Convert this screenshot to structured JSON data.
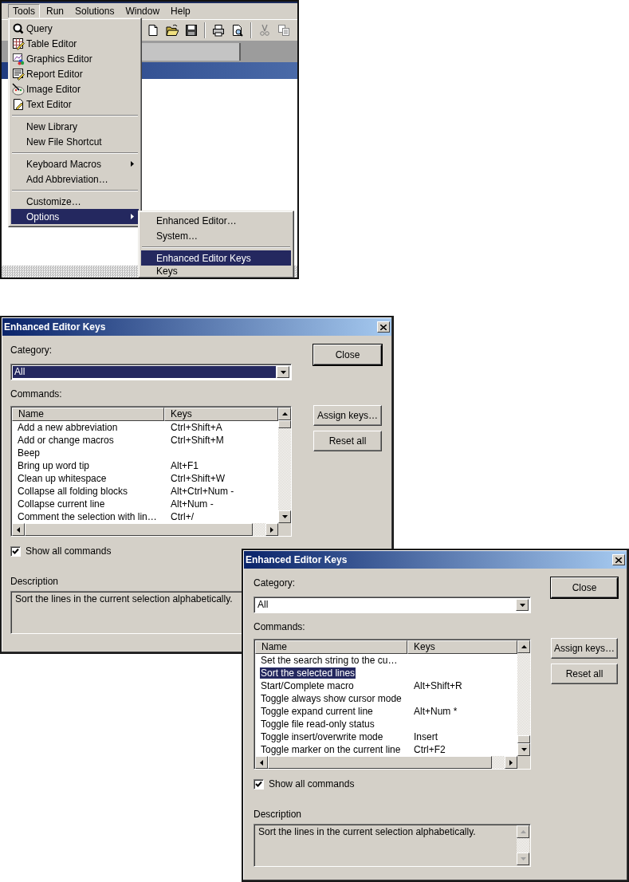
{
  "menu_screenshot": {
    "menubar": [
      {
        "label": "Tools",
        "selected": true
      },
      {
        "label": "Run",
        "selected": false
      },
      {
        "label": "Solutions",
        "selected": false
      },
      {
        "label": "Window",
        "selected": false
      },
      {
        "label": "Help",
        "selected": false
      }
    ],
    "tools_menu": {
      "groups": [
        [
          {
            "label": "Query",
            "kind": "icon",
            "submenu": false,
            "selected": false
          },
          {
            "label": "Table Editor",
            "kind": "icon",
            "submenu": false,
            "selected": false
          },
          {
            "label": "Graphics Editor",
            "kind": "icon",
            "submenu": false,
            "selected": false
          },
          {
            "label": "Report Editor",
            "kind": "icon",
            "submenu": false,
            "selected": false
          },
          {
            "label": "Image Editor",
            "kind": "icon",
            "submenu": false,
            "selected": false
          },
          {
            "label": "Text Editor",
            "kind": "icon",
            "submenu": false,
            "selected": false
          }
        ],
        [
          {
            "label": "New Library",
            "kind": "plain",
            "submenu": false,
            "selected": false
          },
          {
            "label": "New File Shortcut",
            "kind": "plain",
            "submenu": false,
            "selected": false
          }
        ],
        [
          {
            "label": "Keyboard Macros",
            "kind": "plain",
            "submenu": true,
            "selected": false
          },
          {
            "label": "Add Abbreviation…",
            "kind": "plain",
            "submenu": false,
            "selected": false
          }
        ],
        [
          {
            "label": "Customize…",
            "kind": "plain",
            "submenu": false,
            "selected": false
          },
          {
            "label": "Options",
            "kind": "plain",
            "submenu": true,
            "selected": true
          }
        ]
      ]
    },
    "options_submenu": {
      "groups": [
        [
          {
            "label": "Enhanced Editor…",
            "kind": "plain",
            "submenu": false,
            "selected": false
          },
          {
            "label": "System…",
            "kind": "plain",
            "submenu": false,
            "selected": false
          }
        ],
        [
          {
            "label": "Enhanced Editor Keys",
            "kind": "plain",
            "submenu": false,
            "selected": true
          },
          {
            "label": "Keys",
            "kind": "plain",
            "submenu": false,
            "selected": false
          }
        ]
      ]
    }
  },
  "dialogs": [
    {
      "title": "Enhanced Editor Keys",
      "category_label": "Category:",
      "category": {
        "value": "All",
        "focused": true
      },
      "commands_label": "Commands:",
      "columns": [
        "Name",
        "Keys"
      ],
      "rows": [
        {
          "name": "Add a new abbreviation",
          "keys": "Ctrl+Shift+A",
          "selected": false
        },
        {
          "name": "Add or change macros",
          "keys": "Ctrl+Shift+M",
          "selected": false
        },
        {
          "name": "Beep",
          "keys": "",
          "selected": false
        },
        {
          "name": "Bring up word tip",
          "keys": "Alt+F1",
          "selected": false
        },
        {
          "name": "Clean up whitespace",
          "keys": "Ctrl+Shift+W",
          "selected": false
        },
        {
          "name": "Collapse all folding blocks",
          "keys": "Alt+Ctrl+Num -",
          "selected": false
        },
        {
          "name": "Collapse current line",
          "keys": "Alt+Num -",
          "selected": false
        },
        {
          "name": "Comment the selection with lin…",
          "keys": "Ctrl+/",
          "selected": false
        }
      ],
      "show_all_commands": {
        "label": "Show all commands",
        "checked": true
      },
      "description_label": "Description",
      "description": "Sort the lines in the current selection alphabetically.",
      "buttons": [
        {
          "label": "Close",
          "default": true
        },
        {
          "label": "Assign keys…",
          "default": false
        },
        {
          "label": "Reset all",
          "default": false
        }
      ]
    },
    {
      "title": "Enhanced Editor Keys",
      "category_label": "Category:",
      "category": {
        "value": "All",
        "focused": false
      },
      "commands_label": "Commands:",
      "columns": [
        "Name",
        "Keys"
      ],
      "rows": [
        {
          "name": "Set the search string to the cu…",
          "keys": "",
          "selected": false
        },
        {
          "name": "Sort the selected lines",
          "keys": "",
          "selected": true
        },
        {
          "name": "Start/Complete macro",
          "keys": "Alt+Shift+R",
          "selected": false
        },
        {
          "name": "Toggle always show cursor mode",
          "keys": "",
          "selected": false
        },
        {
          "name": "Toggle expand current line",
          "keys": "Alt+Num *",
          "selected": false
        },
        {
          "name": "Toggle file read-only status",
          "keys": "",
          "selected": false
        },
        {
          "name": "Toggle insert/overwrite mode",
          "keys": "Insert",
          "selected": false
        },
        {
          "name": "Toggle marker on the current line",
          "keys": "Ctrl+F2",
          "selected": false
        }
      ],
      "show_all_commands": {
        "label": "Show all commands",
        "checked": true
      },
      "description_label": "Description",
      "description": "Sort the lines in the current selection alphabetically.",
      "description_scrollbar": true,
      "buttons": [
        {
          "label": "Close",
          "default": true
        },
        {
          "label": "Assign keys…",
          "default": false
        },
        {
          "label": "Reset all",
          "default": false
        }
      ]
    }
  ]
}
